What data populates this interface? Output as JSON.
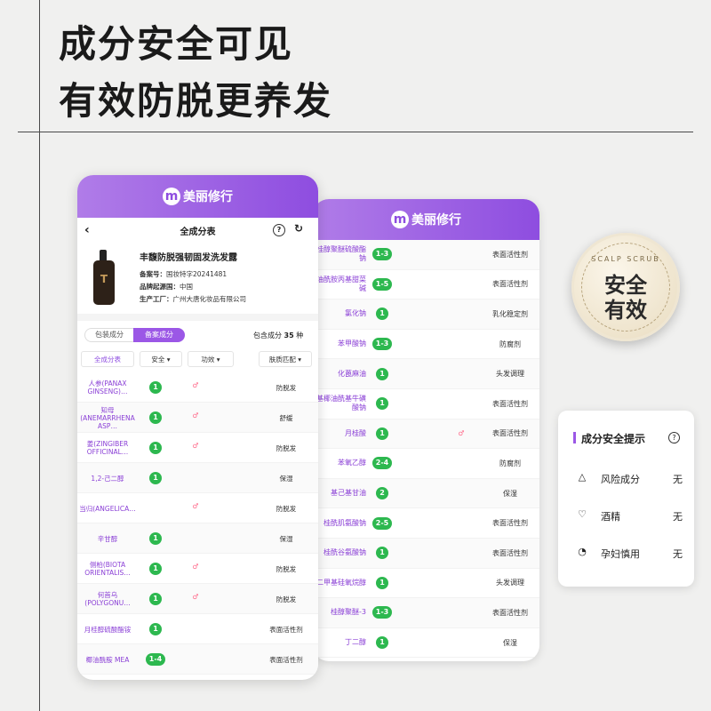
{
  "headline": {
    "line1": "成分安全可见",
    "line2": "有效防脱更养发"
  },
  "brand": {
    "logo_letter": "m",
    "name": "美丽修行",
    "accent": "#9b57e6",
    "safe_green": "#2db84f"
  },
  "page": {
    "nav_title": "全成分表",
    "back_icon": "‹",
    "help_icon": "?",
    "share_icon": "↻"
  },
  "product": {
    "name": "丰馥防脱强韧固发洗发露",
    "reg_label": "备案号：",
    "reg_value": "国妆特字20241481",
    "origin_label": "品牌起源国：",
    "origin_value": "中国",
    "factory_label": "生产工厂：",
    "factory_value": "广州大唐化妆品有限公司",
    "bottle_mark": "T"
  },
  "tabs": {
    "tab1": "包装成分",
    "tab2": "备案成分",
    "total_prefix": "包含成分",
    "total_count": "35",
    "total_suffix": "种"
  },
  "filters": {
    "all": "全成分表",
    "safety": "安全 ▾",
    "function": "功效 ▾",
    "skin": "肤质匹配 ▾"
  },
  "ingredients": [
    {
      "name": "人参(PANAX GINSENG)…",
      "safety": "1",
      "fx": "♂",
      "use": "防脱发"
    },
    {
      "name": "知母(ANEMARRHENA ASP…",
      "safety": "1",
      "fx": "♂",
      "use": "舒缓"
    },
    {
      "name": "姜(ZINGIBER OFFICINAL…",
      "safety": "1",
      "fx": "♂",
      "use": "防脱发"
    },
    {
      "name": "1,2-己二醇",
      "safety": "1",
      "fx": "",
      "use": "保湿"
    },
    {
      "name": "当归(ANGELICA…",
      "safety": "",
      "fx": "♂",
      "use": "防脱发"
    },
    {
      "name": "辛甘醇",
      "safety": "1",
      "fx": "",
      "use": "保湿"
    },
    {
      "name": "侧柏(BIOTA ORIENTALIS…",
      "safety": "1",
      "fx": "♂",
      "use": "防脱发"
    },
    {
      "name": "何首乌(POLYGONU…",
      "safety": "1",
      "fx": "♂",
      "use": "防脱发"
    },
    {
      "name": "月桂醇硫酸酯铵",
      "safety": "1",
      "fx": "",
      "use": "表面活性剂"
    },
    {
      "name": "椰油酰胺 MEA",
      "safety": "1-4",
      "fx": "",
      "use": "表面活性剂"
    }
  ],
  "back_ingredients": [
    {
      "name": "桂醇聚醚硫酸酯钠",
      "safety": "1-3",
      "fx": "",
      "use": "表面活性剂"
    },
    {
      "name": "油酰胺丙基甜菜碱",
      "safety": "1-5",
      "fx": "",
      "use": "表面活性剂"
    },
    {
      "name": "氯化钠",
      "safety": "1",
      "fx": "",
      "use": "乳化稳定剂"
    },
    {
      "name": "苯甲酸钠",
      "safety": "1-3",
      "fx": "",
      "use": "防腐剂"
    },
    {
      "name": "化蓖麻油",
      "safety": "1",
      "fx": "",
      "use": "头发调理"
    },
    {
      "name": "基椰油酰基牛磺酸钠",
      "safety": "1",
      "fx": "",
      "use": "表面活性剂"
    },
    {
      "name": "月桂酸",
      "safety": "1",
      "fx": "♂",
      "use": "表面活性剂"
    },
    {
      "name": "苯氧乙醇",
      "safety": "2-4",
      "fx": "",
      "use": "防腐剂"
    },
    {
      "name": "基己基甘油",
      "safety": "2",
      "fx": "",
      "use": "保湿"
    },
    {
      "name": "桂酰肌氨酸钠",
      "safety": "2-5",
      "fx": "",
      "use": "表面活性剂"
    },
    {
      "name": "桂酰谷氨酸钠",
      "safety": "1",
      "fx": "",
      "use": "表面活性剂"
    },
    {
      "name": "二甲基硅氧烷醇",
      "safety": "1",
      "fx": "",
      "use": "头发调理"
    },
    {
      "name": "桂醇聚醚-3",
      "safety": "1-3",
      "fx": "",
      "use": "表面活性剂"
    },
    {
      "name": "丁二醇",
      "safety": "1",
      "fx": "",
      "use": "保湿"
    }
  ],
  "badge": {
    "arc_text": "SCALP SCRUB",
    "line1": "安全",
    "line2": "有效"
  },
  "tip": {
    "title": "成分安全提示",
    "help_icon": "?",
    "rows": [
      {
        "icon": "△",
        "label": "风险成分",
        "value": "无"
      },
      {
        "icon": "♡",
        "label": "酒精",
        "value": "无"
      },
      {
        "icon": "◔",
        "label": "孕妇慎用",
        "value": "无"
      }
    ]
  }
}
